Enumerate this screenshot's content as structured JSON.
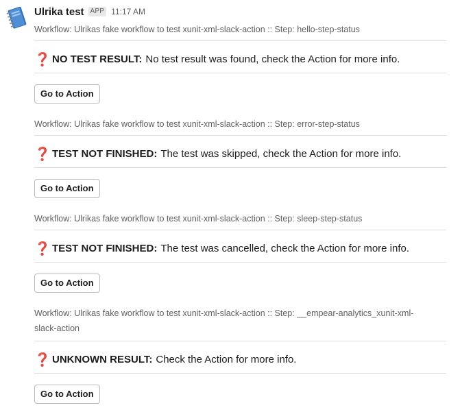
{
  "message": {
    "username": "Ulrika test",
    "badge": "APP",
    "timestamp": "11:17 AM"
  },
  "blocks": [
    {
      "context": "Workflow: Ulrikas fake workflow to test xunit-xml-slack-action :: Step: hello-step-status",
      "status_label": "NO TEST RESULT:",
      "status_text": "No test result was found, check the Action for more info.",
      "button_label": "Go to Action"
    },
    {
      "context": "Workflow: Ulrikas fake workflow to test xunit-xml-slack-action :: Step: error-step-status",
      "status_label": "TEST NOT FINISHED:",
      "status_text": "The test was skipped, check the Action for more info.",
      "button_label": "Go to Action"
    },
    {
      "context": "Workflow: Ulrikas fake workflow to test xunit-xml-slack-action :: Step: sleep-step-status",
      "status_label": "TEST NOT FINISHED:",
      "status_text": "The test was cancelled, check the Action for more info.",
      "button_label": "Go to Action"
    },
    {
      "context_line1": "Workflow: Ulrikas fake workflow to test xunit-xml-slack-action :: Step: __empear-analytics_xunit-xml-",
      "context_line2": "slack-action",
      "status_label": "UNKNOWN RESULT:",
      "status_text": "Check the Action for more info.",
      "button_label": "Go to Action"
    }
  ],
  "icons": {
    "avatar": "notebook-icon",
    "status": "question-mark-icon"
  },
  "colors": {
    "question_mark": "#d7263d",
    "muted_text": "#616061",
    "divider": "#dddddd"
  }
}
